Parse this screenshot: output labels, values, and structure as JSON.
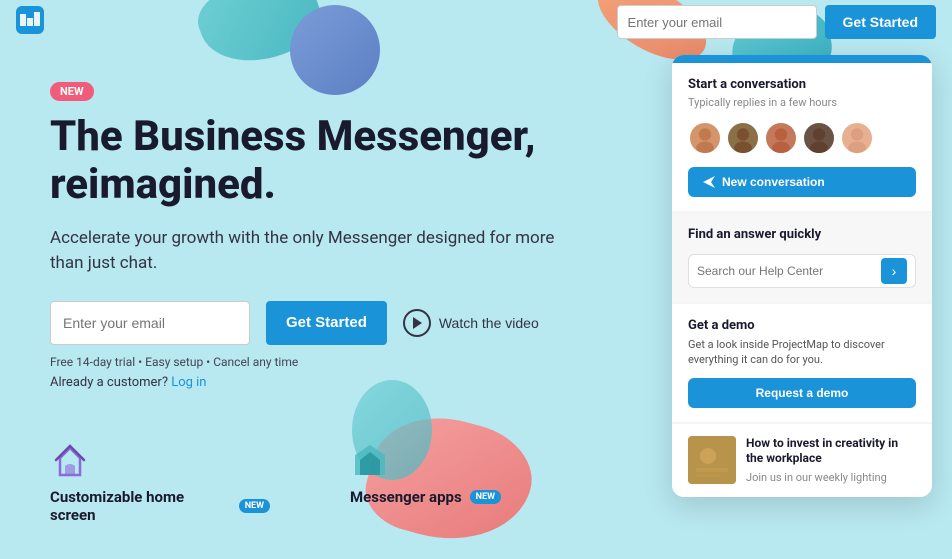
{
  "nav": {
    "email_placeholder": "Enter your email",
    "get_started_label": "Get Started"
  },
  "hero": {
    "badge_label": "NEW",
    "title_line1": "The Business Messenger,",
    "title_line2": "reimagined.",
    "subtitle": "Accelerate your growth with the only Messenger designed for more than just chat.",
    "email_placeholder": "Enter your email",
    "cta_label": "Get Started",
    "watch_video_label": "Watch the video",
    "meta": "Free 14-day trial  •  Easy setup  •  Cancel any time",
    "login_prefix": "Already a customer?",
    "login_label": "Log in"
  },
  "features": [
    {
      "title": "Customizable home screen",
      "badge": "NEW",
      "icon_color": "#8b6bd9"
    },
    {
      "title": "Messenger apps",
      "badge": "NEW",
      "icon_color": "#4ab8c1"
    }
  ],
  "widget": {
    "conversation_section": {
      "title": "Start a conversation",
      "subtitle": "Typically replies in a few hours",
      "new_convo_label": "New conversation"
    },
    "search_section": {
      "title": "Find an answer quickly",
      "placeholder": "Search our Help Center"
    },
    "demo_section": {
      "title": "Get a demo",
      "description": "Get a look inside ProjectMap to discover everything it can do for you.",
      "button_label": "Request a demo"
    },
    "article_section": {
      "title": "How to invest in creativity in the workplace",
      "subtitle": "Join us in our weekly lighting"
    }
  }
}
